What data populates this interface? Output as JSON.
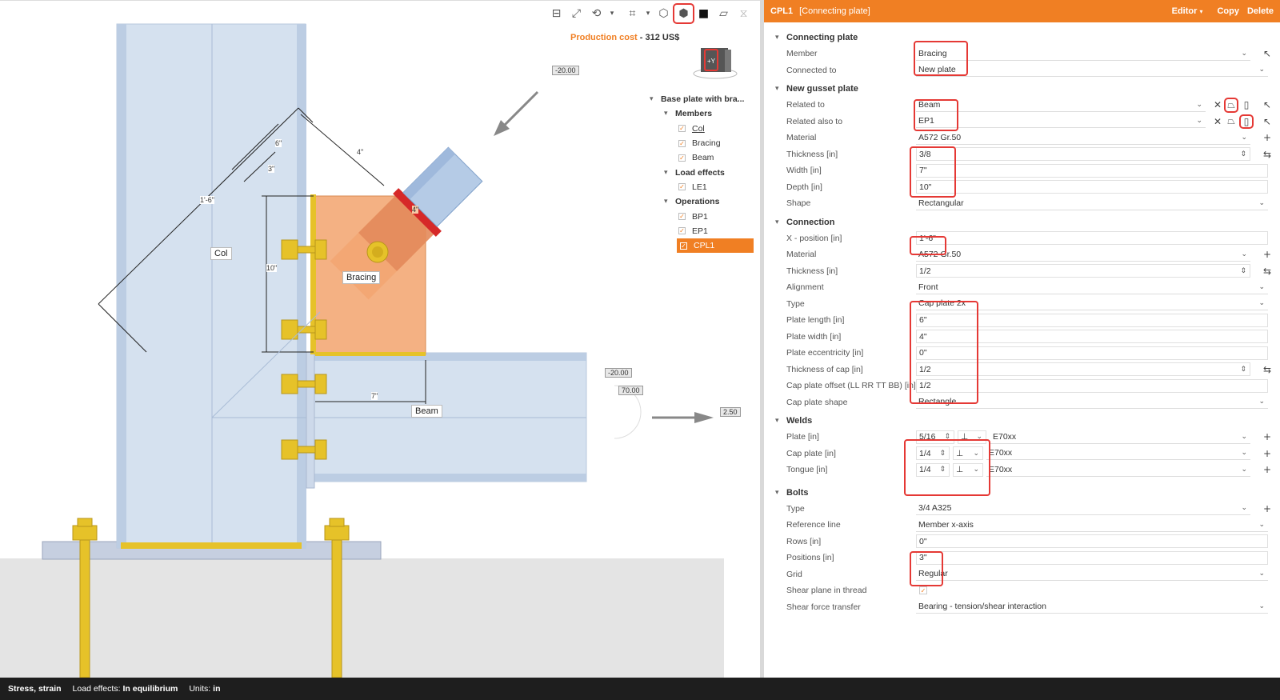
{
  "toolbar": {
    "icons": [
      "ruler-icon",
      "fit-icon",
      "rotate-icon",
      "chevron-down-icon",
      "crop-icon",
      "chevron-down-icon",
      "wireframe-cube-icon",
      "transparent-cube-icon",
      "solid-cube-icon",
      "section-icon",
      "mirror-icon",
      "home-icon"
    ]
  },
  "production_cost": {
    "label": "Production cost",
    "separator": " - ",
    "value": "312 US$"
  },
  "navcube": {
    "label": "+Y"
  },
  "tree": {
    "root": "Base plate with bra...",
    "members_label": "Members",
    "members": [
      "Col",
      "Bracing",
      "Beam"
    ],
    "load_effects_label": "Load effects",
    "load_effects": [
      "LE1"
    ],
    "operations_label": "Operations",
    "operations": [
      "BP1",
      "EP1",
      "CPL1"
    ]
  },
  "scene": {
    "labels": {
      "col": "Col",
      "bracing": "Bracing",
      "beam": "Beam"
    },
    "dims": {
      "d1": "1'-6\"",
      "d2": "6\"",
      "d3": "3\"",
      "d4": "4\"",
      "d5": "10\"",
      "d6": "7\"",
      "d7": "4\""
    },
    "loads": {
      "l1": "-20.00",
      "l2": "-20.00",
      "l3": "70.00",
      "l4": "2.50"
    }
  },
  "panel": {
    "code": "CPL1",
    "title": "[Connecting plate]",
    "actions": {
      "editor": "Editor",
      "copy": "Copy",
      "delete": "Delete"
    },
    "connecting_plate": {
      "title": "Connecting plate",
      "member_label": "Member",
      "member": "Bracing",
      "connected_to_label": "Connected to",
      "connected_to": "New plate"
    },
    "gusset": {
      "title": "New gusset plate",
      "related_to_label": "Related to",
      "related_to": "Beam",
      "related_also_label": "Related also to",
      "related_also": "EP1",
      "material_label": "Material",
      "material": "A572 Gr.50",
      "thickness_label": "Thickness [in]",
      "thickness": "3/8",
      "width_label": "Width [in]",
      "width": "7\"",
      "depth_label": "Depth [in]",
      "depth": "10\"",
      "shape_label": "Shape",
      "shape": "Rectangular"
    },
    "connection": {
      "title": "Connection",
      "xpos_label": "X - position [in]",
      "xpos": "1'-6\"",
      "material_label": "Material",
      "material": "A572 Gr.50",
      "thickness_label": "Thickness [in]",
      "thickness": "1/2",
      "alignment_label": "Alignment",
      "alignment": "Front",
      "type_label": "Type",
      "type": "Cap plate 2x",
      "plen_label": "Plate length [in]",
      "plen": "6\"",
      "pwid_label": "Plate width [in]",
      "pwid": "4\"",
      "pecc_label": "Plate eccentricity [in]",
      "pecc": "0\"",
      "tcap_label": "Thickness of cap [in]",
      "tcap": "1/2",
      "offset_label": "Cap plate offset (LL RR TT BB) [in]",
      "offset": "1/2",
      "shape_label": "Cap plate shape",
      "shape": "Rectangle"
    },
    "welds": {
      "title": "Welds",
      "plate_label": "Plate [in]",
      "plate": "5/16",
      "plate_mat": "E70xx",
      "cap_label": "Cap plate [in]",
      "cap": "1/4",
      "cap_mat": "E70xx",
      "tongue_label": "Tongue [in]",
      "tongue": "1/4",
      "tongue_mat": "E70xx"
    },
    "bolts": {
      "title": "Bolts",
      "type_label": "Type",
      "type": "3/4 A325",
      "ref_label": "Reference line",
      "ref": "Member x-axis",
      "rows_label": "Rows [in]",
      "rows": "0\"",
      "pos_label": "Positions [in]",
      "pos": "3\"",
      "grid_label": "Grid",
      "grid": "Regular",
      "shear_label": "Shear plane in thread",
      "transfer_label": "Shear force transfer",
      "transfer": "Bearing - tension/shear interaction"
    }
  },
  "status": {
    "mode": "Stress, strain",
    "load_label": "Load effects:",
    "load_value": "In equilibrium",
    "units_label": "Units:",
    "units_value": "in"
  },
  "colors": {
    "accent": "#f07f23",
    "highlight": "#e53935",
    "steel": "#cfdcec",
    "bolt": "#e6c229"
  }
}
